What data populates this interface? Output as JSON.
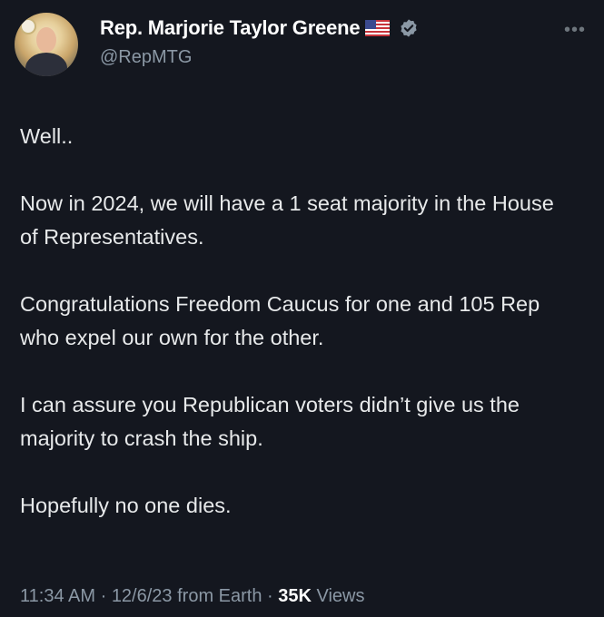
{
  "author": {
    "name": "Rep. Marjorie Taylor Greene",
    "handle": "@RepMTG",
    "flag_icon": "us-flag-icon",
    "verified_icon": "verified-badge-icon",
    "verified_color": "#8b98a5"
  },
  "menu": {
    "more_label": "•••"
  },
  "tweet": {
    "paragraphs": [
      "Well..",
      "Now in 2024, we will have a 1 seat majority in the House of Representatives.",
      "Congratulations Freedom Caucus for one and 105 Rep who expel our own for the other.",
      "I can assure you Republican voters didn’t give us the majority to crash the ship.",
      "Hopefully no one dies."
    ]
  },
  "meta": {
    "time": "11:34 AM",
    "sep1": " · ",
    "date": "12/6/23",
    "source": " from Earth",
    "sep2": " · ",
    "views_count": "35K",
    "views_label": " Views"
  },
  "colors": {
    "background": "#14171f",
    "text": "#e7e9ea",
    "secondary": "#8b98a5"
  }
}
